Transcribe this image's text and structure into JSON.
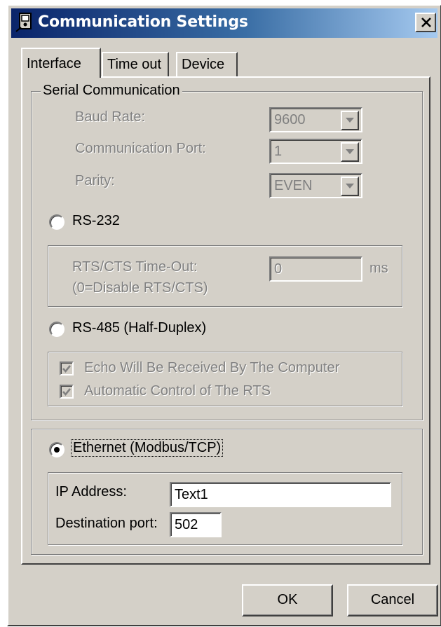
{
  "window": {
    "title": "Communication Settings",
    "app_icon": "meter-app-icon",
    "close_icon": "close-icon"
  },
  "tabs": [
    {
      "label": "Interface",
      "active": true
    },
    {
      "label": "Time out",
      "active": false
    },
    {
      "label": "Device",
      "active": false
    }
  ],
  "serial": {
    "group_label": "Serial Communication",
    "baud_rate": {
      "label": "Baud Rate:",
      "value": "9600"
    },
    "comm_port": {
      "label": "Communication Port:",
      "value": "1"
    },
    "parity": {
      "label": "Parity:",
      "value": "EVEN"
    },
    "rs232": {
      "label": "RS-232",
      "selected": false,
      "rts_label_line1": "RTS/CTS Time-Out:",
      "rts_label_line2": "(0=Disable RTS/CTS)",
      "rts_value": "0",
      "rts_unit": "ms"
    },
    "rs485": {
      "label": "RS-485 (Half-Duplex)",
      "selected": false,
      "echo_label": "Echo Will Be Received By The Computer",
      "echo_checked": true,
      "rts_auto_label": "Automatic Control of The RTS",
      "rts_auto_checked": true
    }
  },
  "ethernet": {
    "label": "Ethernet (Modbus/TCP)",
    "selected": true,
    "ip_label": "IP Address:",
    "ip_value": "Text1",
    "port_label": "Destination port:",
    "port_value": "502"
  },
  "buttons": {
    "ok": "OK",
    "cancel": "Cancel"
  },
  "colors": {
    "face": "#d4d0c8",
    "title_start": "#0a246a",
    "title_end": "#a6caf0",
    "disabled_text": "#808080"
  }
}
